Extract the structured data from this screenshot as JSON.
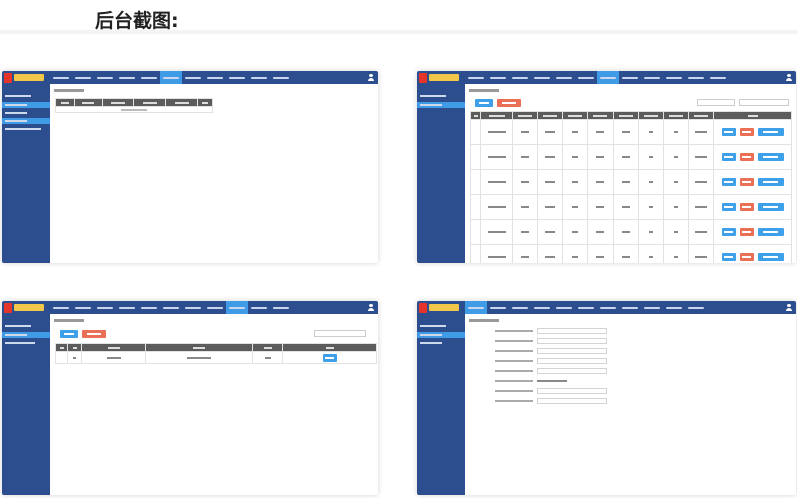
{
  "page": {
    "heading": "后台截图:"
  },
  "colors": {
    "topbar": "#2d4e8e",
    "active": "#3f9be6",
    "primary_button": "#3fa0ea",
    "danger_button": "#ea6f55",
    "table_header": "#5c5c5c"
  },
  "screenshots": [
    {
      "id": "list-empty",
      "active_nav_index": 6,
      "nav_count": 14
    },
    {
      "id": "product-list",
      "active_nav_index": 7,
      "nav_count": 14,
      "rows": 6
    },
    {
      "id": "simple-list",
      "active_nav_index": 11,
      "nav_count": 14,
      "rows": 1
    },
    {
      "id": "form-page",
      "active_nav_index": 0,
      "nav_count": 14,
      "form_fields": 8
    }
  ],
  "icons": [
    "user-icon",
    "logo-icon"
  ]
}
